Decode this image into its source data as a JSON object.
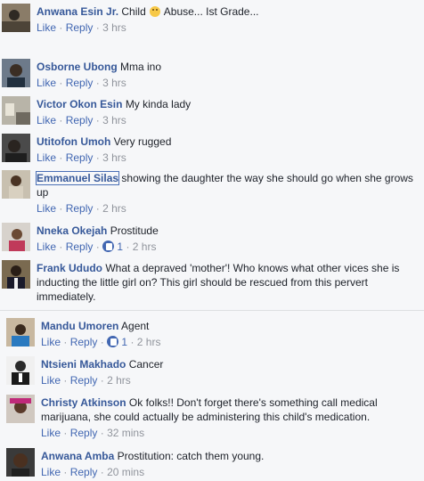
{
  "comments": [
    {
      "name": "Anwana Esin Jr.",
      "text": "Child",
      "emoji": "surprised-emoji",
      "text2": "Abuse... Ist Grade...",
      "actions": {
        "like": "Like",
        "reply": "Reply",
        "time": "3 hrs"
      }
    },
    {
      "name": "Osborne Ubong",
      "text": "Mma ino",
      "actions": {
        "like": "Like",
        "reply": "Reply",
        "time": "3 hrs"
      }
    },
    {
      "name": "Victor Okon Esin",
      "text": "My kinda lady",
      "actions": {
        "like": "Like",
        "reply": "Reply",
        "time": "3 hrs"
      }
    },
    {
      "name": "Utitofon Umoh",
      "text": "Very rugged",
      "actions": {
        "like": "Like",
        "reply": "Reply",
        "time": "3 hrs"
      }
    },
    {
      "name": "Emmanuel Silas",
      "text": "showing the daughter the way she should go when she grows up",
      "actions": {
        "like": "Like",
        "reply": "Reply",
        "time": "2 hrs"
      }
    },
    {
      "name": "Nneka Okejah",
      "text": "Prostitude",
      "actions": {
        "like": "Like",
        "reply": "Reply",
        "likes": "1",
        "time": "2 hrs"
      }
    },
    {
      "name": "Frank Ududo",
      "text": "What a depraved 'mother'! Who knows what other vices she is inducting the little girl on? This girl should be rescued from this pervert immediately.",
      "actions": {}
    }
  ],
  "replies": [
    {
      "name": "Mandu Umoren",
      "text": "Agent",
      "actions": {
        "like": "Like",
        "reply": "Reply",
        "likes": "1",
        "time": "2 hrs"
      }
    },
    {
      "name": "Ntsieni Makhado",
      "text": "Cancer",
      "actions": {
        "like": "Like",
        "reply": "Reply",
        "time": "2 hrs"
      }
    },
    {
      "name": "Christy Atkinson",
      "text": "Ok folks!! Don't forget there's something call medical marijuana, she could actually be administering this child's medication.",
      "actions": {
        "like": "Like",
        "reply": "Reply",
        "time": "32 mins"
      }
    },
    {
      "name": "Anwana Amba",
      "text": "Prostitution: catch them young.",
      "actions": {
        "like": "Like",
        "reply": "Reply",
        "time": "20 mins"
      }
    }
  ],
  "separator": "·",
  "colors": {
    "name": "#365899",
    "link": "#4267b2",
    "meta": "#90949c",
    "bg": "#f6f7f9"
  }
}
